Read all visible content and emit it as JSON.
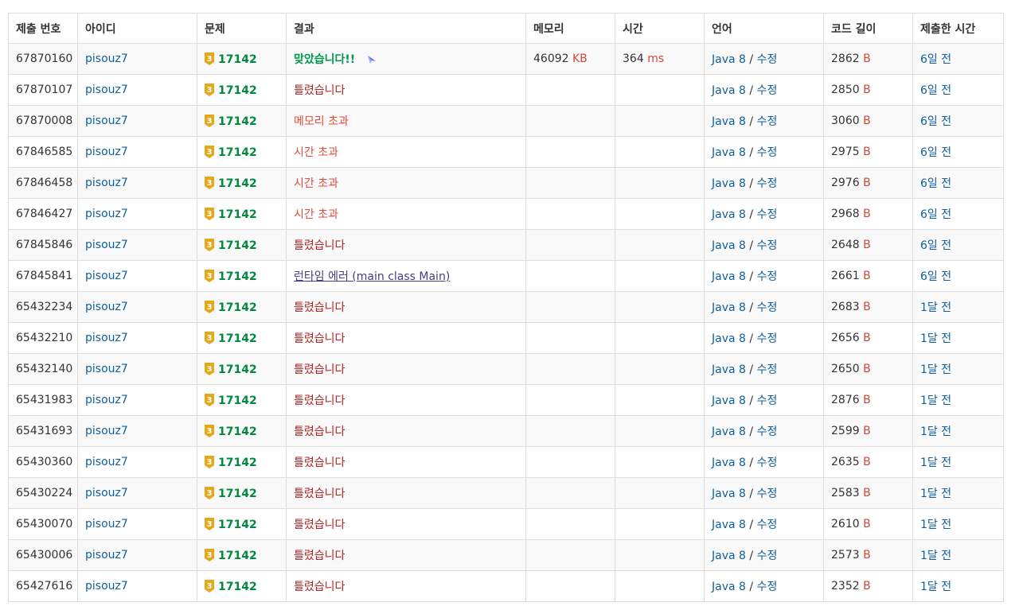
{
  "colors": {
    "link": "#0f5f9c",
    "problem": "#008a3e",
    "wrong": "#b22222",
    "tle": "#e24c3c",
    "accepted": "#00984d",
    "tier_gold": "#e6a817"
  },
  "headers": [
    "제출 번호",
    "아이디",
    "문제",
    "결과",
    "메모리",
    "시간",
    "언어",
    "코드 길이",
    "제출한 시간"
  ],
  "rows": [
    {
      "id": "67870160",
      "user": "pisouz7",
      "tier": "3",
      "problem": "17142",
      "result": "맞았습니다!!",
      "rclass": "res-ac",
      "memory": "46092",
      "memory_unit": "KB",
      "time": "364",
      "time_unit": "ms",
      "lang": "Java 8",
      "edit": "수정",
      "length": "2862",
      "length_unit": "B",
      "submitted": "6일 전"
    },
    {
      "id": "67870107",
      "user": "pisouz7",
      "tier": "3",
      "problem": "17142",
      "result": "틀렸습니다",
      "rclass": "res-wa",
      "memory": "",
      "memory_unit": "",
      "time": "",
      "time_unit": "",
      "lang": "Java 8",
      "edit": "수정",
      "length": "2850",
      "length_unit": "B",
      "submitted": "6일 전"
    },
    {
      "id": "67870008",
      "user": "pisouz7",
      "tier": "3",
      "problem": "17142",
      "result": "메모리 초과",
      "rclass": "res-mle",
      "memory": "",
      "memory_unit": "",
      "time": "",
      "time_unit": "",
      "lang": "Java 8",
      "edit": "수정",
      "length": "3060",
      "length_unit": "B",
      "submitted": "6일 전"
    },
    {
      "id": "67846585",
      "user": "pisouz7",
      "tier": "3",
      "problem": "17142",
      "result": "시간 초과",
      "rclass": "res-tle",
      "memory": "",
      "memory_unit": "",
      "time": "",
      "time_unit": "",
      "lang": "Java 8",
      "edit": "수정",
      "length": "2975",
      "length_unit": "B",
      "submitted": "6일 전"
    },
    {
      "id": "67846458",
      "user": "pisouz7",
      "tier": "3",
      "problem": "17142",
      "result": "시간 초과",
      "rclass": "res-tle",
      "memory": "",
      "memory_unit": "",
      "time": "",
      "time_unit": "",
      "lang": "Java 8",
      "edit": "수정",
      "length": "2976",
      "length_unit": "B",
      "submitted": "6일 전"
    },
    {
      "id": "67846427",
      "user": "pisouz7",
      "tier": "3",
      "problem": "17142",
      "result": "시간 초과",
      "rclass": "res-tle",
      "memory": "",
      "memory_unit": "",
      "time": "",
      "time_unit": "",
      "lang": "Java 8",
      "edit": "수정",
      "length": "2968",
      "length_unit": "B",
      "submitted": "6일 전"
    },
    {
      "id": "67845846",
      "user": "pisouz7",
      "tier": "3",
      "problem": "17142",
      "result": "틀렸습니다",
      "rclass": "res-wa",
      "memory": "",
      "memory_unit": "",
      "time": "",
      "time_unit": "",
      "lang": "Java 8",
      "edit": "수정",
      "length": "2648",
      "length_unit": "B",
      "submitted": "6일 전"
    },
    {
      "id": "67845841",
      "user": "pisouz7",
      "tier": "3",
      "problem": "17142",
      "result": "런타임 에러 (main class Main)",
      "rclass": "res-rte",
      "memory": "",
      "memory_unit": "",
      "time": "",
      "time_unit": "",
      "lang": "Java 8",
      "edit": "수정",
      "length": "2661",
      "length_unit": "B",
      "submitted": "6일 전"
    },
    {
      "id": "65432234",
      "user": "pisouz7",
      "tier": "3",
      "problem": "17142",
      "result": "틀렸습니다",
      "rclass": "res-wa",
      "memory": "",
      "memory_unit": "",
      "time": "",
      "time_unit": "",
      "lang": "Java 8",
      "edit": "수정",
      "length": "2683",
      "length_unit": "B",
      "submitted": "1달 전"
    },
    {
      "id": "65432210",
      "user": "pisouz7",
      "tier": "3",
      "problem": "17142",
      "result": "틀렸습니다",
      "rclass": "res-wa",
      "memory": "",
      "memory_unit": "",
      "time": "",
      "time_unit": "",
      "lang": "Java 8",
      "edit": "수정",
      "length": "2656",
      "length_unit": "B",
      "submitted": "1달 전"
    },
    {
      "id": "65432140",
      "user": "pisouz7",
      "tier": "3",
      "problem": "17142",
      "result": "틀렸습니다",
      "rclass": "res-wa",
      "memory": "",
      "memory_unit": "",
      "time": "",
      "time_unit": "",
      "lang": "Java 8",
      "edit": "수정",
      "length": "2650",
      "length_unit": "B",
      "submitted": "1달 전"
    },
    {
      "id": "65431983",
      "user": "pisouz7",
      "tier": "3",
      "problem": "17142",
      "result": "틀렸습니다",
      "rclass": "res-wa",
      "memory": "",
      "memory_unit": "",
      "time": "",
      "time_unit": "",
      "lang": "Java 8",
      "edit": "수정",
      "length": "2876",
      "length_unit": "B",
      "submitted": "1달 전"
    },
    {
      "id": "65431693",
      "user": "pisouz7",
      "tier": "3",
      "problem": "17142",
      "result": "틀렸습니다",
      "rclass": "res-wa",
      "memory": "",
      "memory_unit": "",
      "time": "",
      "time_unit": "",
      "lang": "Java 8",
      "edit": "수정",
      "length": "2599",
      "length_unit": "B",
      "submitted": "1달 전"
    },
    {
      "id": "65430360",
      "user": "pisouz7",
      "tier": "3",
      "problem": "17142",
      "result": "틀렸습니다",
      "rclass": "res-wa",
      "memory": "",
      "memory_unit": "",
      "time": "",
      "time_unit": "",
      "lang": "Java 8",
      "edit": "수정",
      "length": "2635",
      "length_unit": "B",
      "submitted": "1달 전"
    },
    {
      "id": "65430224",
      "user": "pisouz7",
      "tier": "3",
      "problem": "17142",
      "result": "틀렸습니다",
      "rclass": "res-wa",
      "memory": "",
      "memory_unit": "",
      "time": "",
      "time_unit": "",
      "lang": "Java 8",
      "edit": "수정",
      "length": "2583",
      "length_unit": "B",
      "submitted": "1달 전"
    },
    {
      "id": "65430070",
      "user": "pisouz7",
      "tier": "3",
      "problem": "17142",
      "result": "틀렸습니다",
      "rclass": "res-wa",
      "memory": "",
      "memory_unit": "",
      "time": "",
      "time_unit": "",
      "lang": "Java 8",
      "edit": "수정",
      "length": "2610",
      "length_unit": "B",
      "submitted": "1달 전"
    },
    {
      "id": "65430006",
      "user": "pisouz7",
      "tier": "3",
      "problem": "17142",
      "result": "틀렸습니다",
      "rclass": "res-wa",
      "memory": "",
      "memory_unit": "",
      "time": "",
      "time_unit": "",
      "lang": "Java 8",
      "edit": "수정",
      "length": "2573",
      "length_unit": "B",
      "submitted": "1달 전"
    },
    {
      "id": "65427616",
      "user": "pisouz7",
      "tier": "3",
      "problem": "17142",
      "result": "틀렸습니다",
      "rclass": "res-wa",
      "memory": "",
      "memory_unit": "",
      "time": "",
      "time_unit": "",
      "lang": "Java 8",
      "edit": "수정",
      "length": "2352",
      "length_unit": "B",
      "submitted": "1달 전"
    }
  ]
}
